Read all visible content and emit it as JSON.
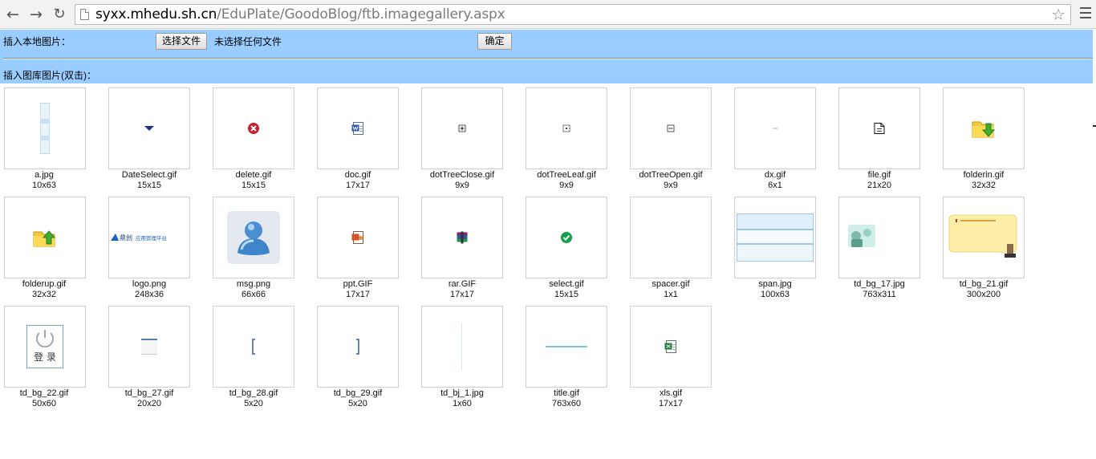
{
  "browser": {
    "url_host": "syxx.mhedu.sh.cn",
    "url_path": "/EduPlate/GoodoBlog/ftb.imagegallery.aspx"
  },
  "upload": {
    "label": "插入本地图片：",
    "file_button": "选择文件",
    "file_status": "未选择任何文件",
    "confirm_button": "确定"
  },
  "gallery": {
    "label": "插入图库图片(双击)：",
    "items": [
      {
        "name": "a.jpg",
        "size": "10x63"
      },
      {
        "name": "DateSelect.gif",
        "size": "15x15"
      },
      {
        "name": "delete.gif",
        "size": "15x15"
      },
      {
        "name": "doc.gif",
        "size": "17x17"
      },
      {
        "name": "dotTreeClose.gif",
        "size": "9x9"
      },
      {
        "name": "dotTreeLeaf.gif",
        "size": "9x9"
      },
      {
        "name": "dotTreeOpen.gif",
        "size": "9x9"
      },
      {
        "name": "dx.gif",
        "size": "6x1"
      },
      {
        "name": "file.gif",
        "size": "21x20"
      },
      {
        "name": "folderin.gif",
        "size": "32x32"
      },
      {
        "name": "folderup.gif",
        "size": "32x32"
      },
      {
        "name": "logo.png",
        "size": "248x36",
        "logo_text_a": "鼎创",
        "logo_text_b": "应用管理平台"
      },
      {
        "name": "msg.png",
        "size": "66x66"
      },
      {
        "name": "ppt.GIF",
        "size": "17x17"
      },
      {
        "name": "rar.GIF",
        "size": "17x17"
      },
      {
        "name": "select.gif",
        "size": "15x15"
      },
      {
        "name": "spacer.gif",
        "size": "1x1"
      },
      {
        "name": "span.jpg",
        "size": "100x63"
      },
      {
        "name": "td_bg_17.jpg",
        "size": "763x311"
      },
      {
        "name": "td_bg_21.gif",
        "size": "300x200"
      },
      {
        "name": "td_bg_22.gif",
        "size": "50x60",
        "button_text": "登 录"
      },
      {
        "name": "td_bg_27.gif",
        "size": "20x20"
      },
      {
        "name": "td_bg_28.gif",
        "size": "5x20"
      },
      {
        "name": "td_bg_29.gif",
        "size": "5x20"
      },
      {
        "name": "td_bj_1.jpg",
        "size": "1x60"
      },
      {
        "name": "title.gif",
        "size": "763x60"
      },
      {
        "name": "xls.gif",
        "size": "17x17"
      }
    ]
  },
  "colors": {
    "panel_bg": "#99ccff",
    "tile_border": "#cfcfcf"
  }
}
